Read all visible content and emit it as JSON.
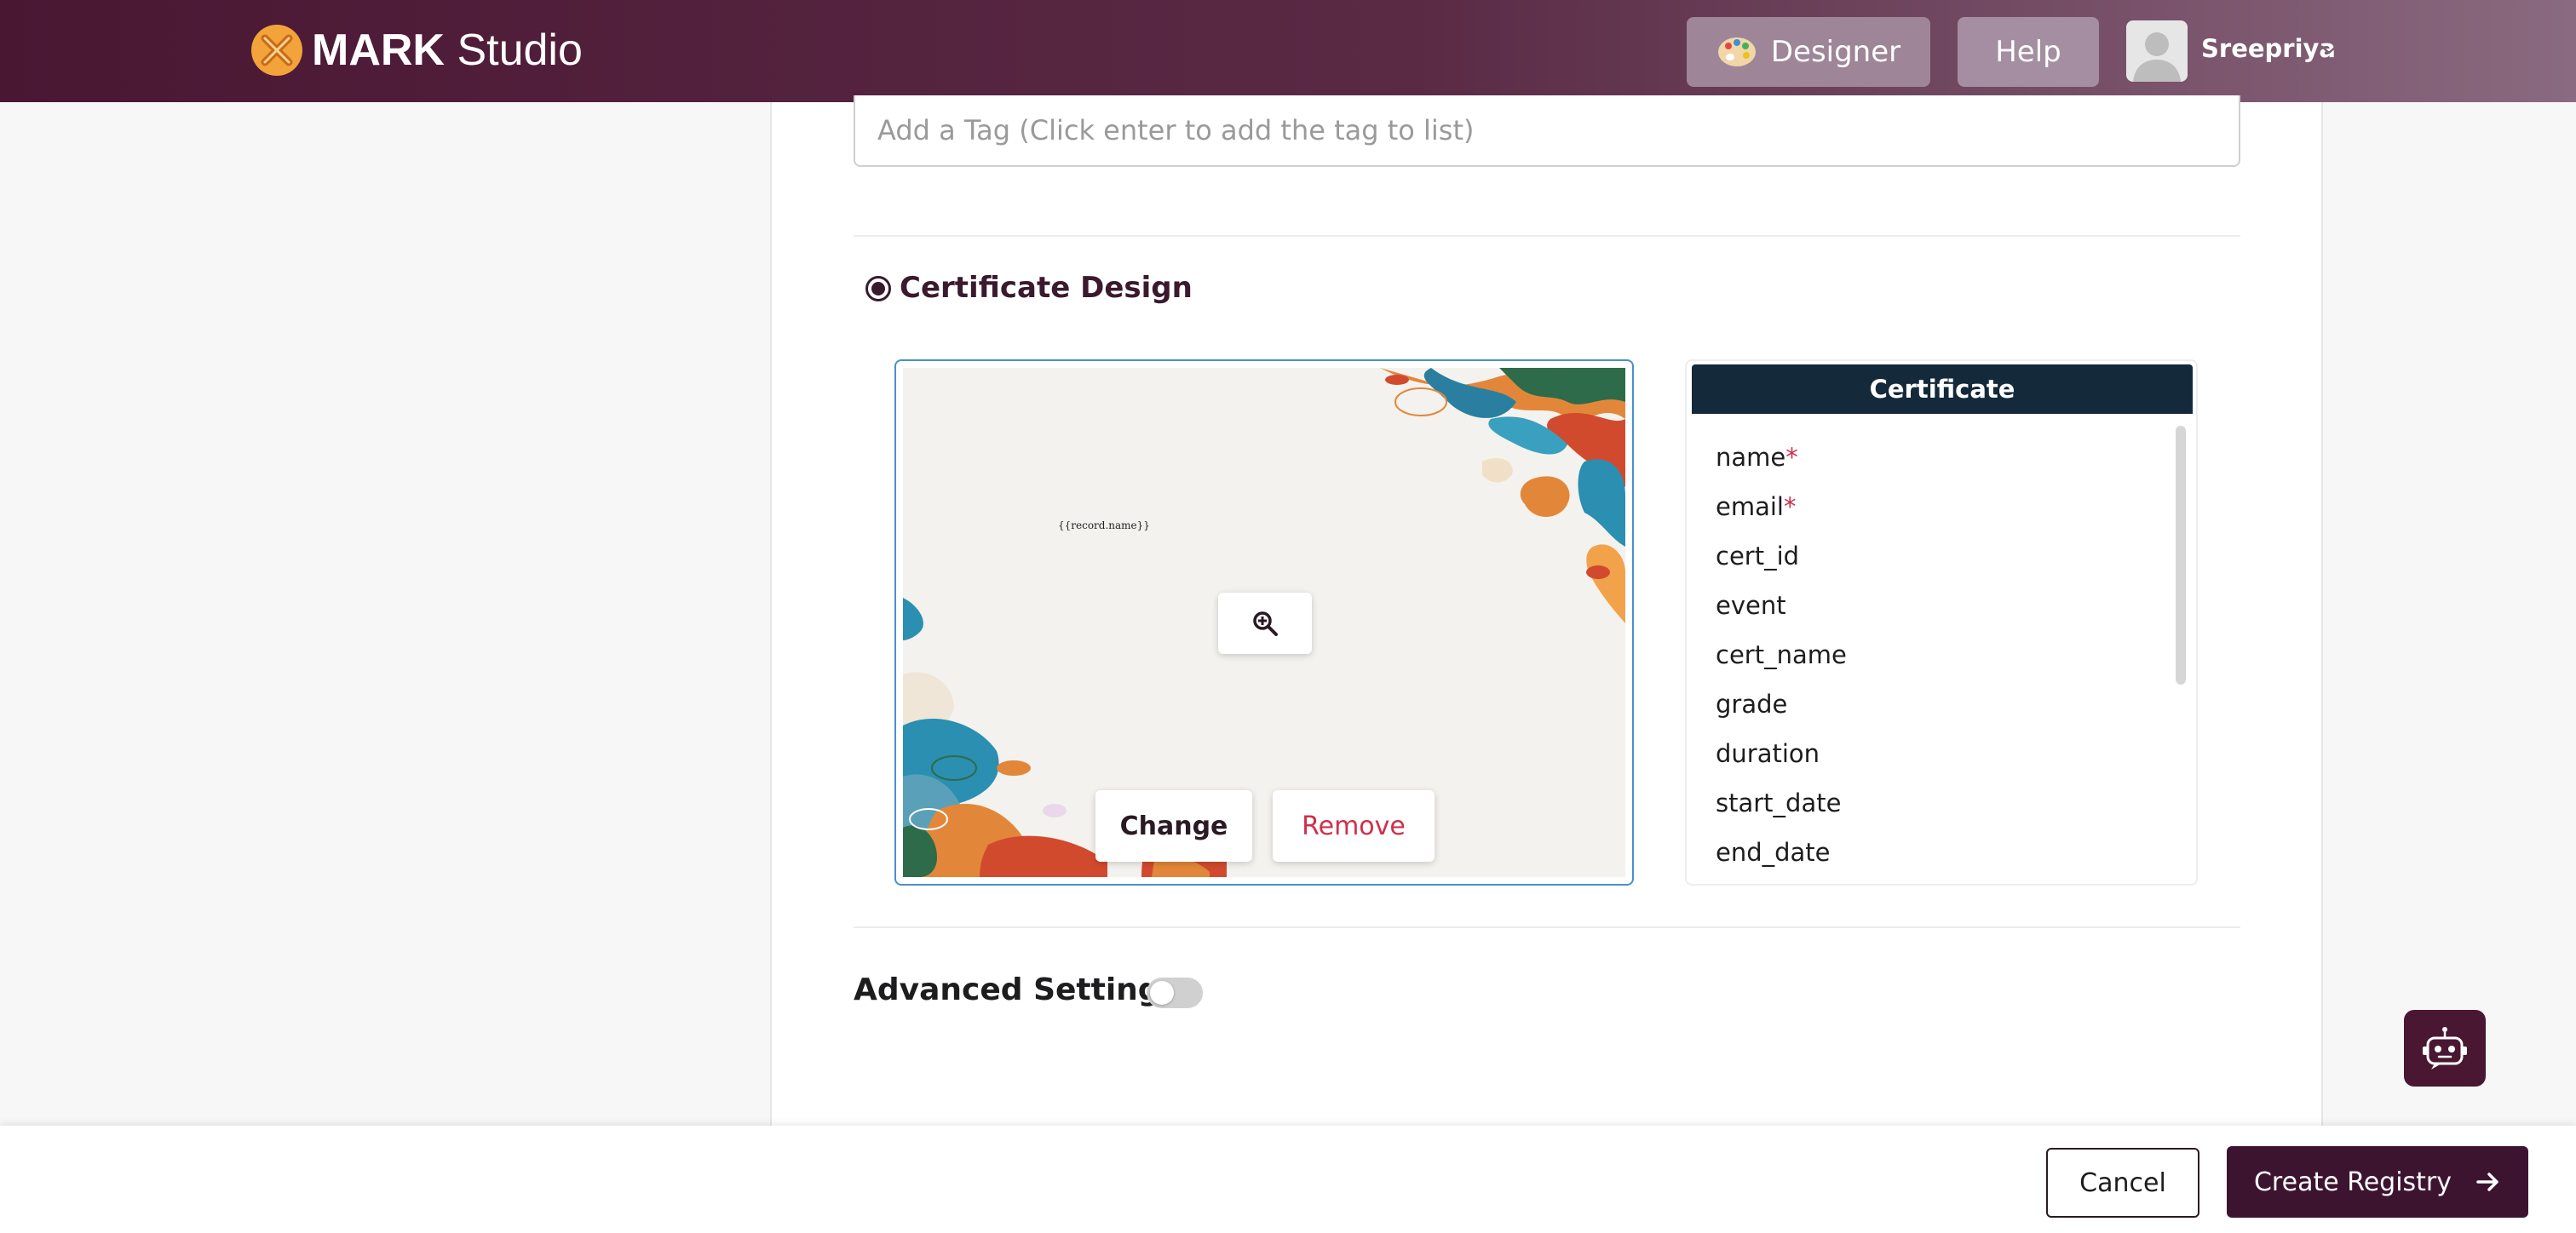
{
  "header": {
    "brand_bold": "MARK",
    "brand_light": "Studio",
    "designer_label": "Designer",
    "help_label": "Help",
    "user_name": "Sreepriya"
  },
  "tags": {
    "placeholder": "Add a Tag (Click enter to add the tag to list)"
  },
  "certificate_design": {
    "title": "Certificate Design",
    "preview_placeholder_text": "{{record.name}}",
    "change_label": "Change",
    "remove_label": "Remove",
    "fields_header": "Certificate",
    "fields": [
      {
        "label": "name",
        "required": "*"
      },
      {
        "label": "email",
        "required": "*"
      },
      {
        "label": "cert_id",
        "required": ""
      },
      {
        "label": "event",
        "required": ""
      },
      {
        "label": "cert_name",
        "required": ""
      },
      {
        "label": "grade",
        "required": ""
      },
      {
        "label": "duration",
        "required": ""
      },
      {
        "label": "start_date",
        "required": ""
      },
      {
        "label": "end_date",
        "required": ""
      }
    ]
  },
  "advanced_settings": {
    "label": "Advanced Settings",
    "enabled": false
  },
  "footer": {
    "cancel_label": "Cancel",
    "create_label": "Create Registry"
  },
  "colors": {
    "brand_dark": "#4a1733",
    "accent_red": "#d12e4a",
    "fields_header_bg": "#14293a",
    "preview_border": "#4a90c8"
  }
}
